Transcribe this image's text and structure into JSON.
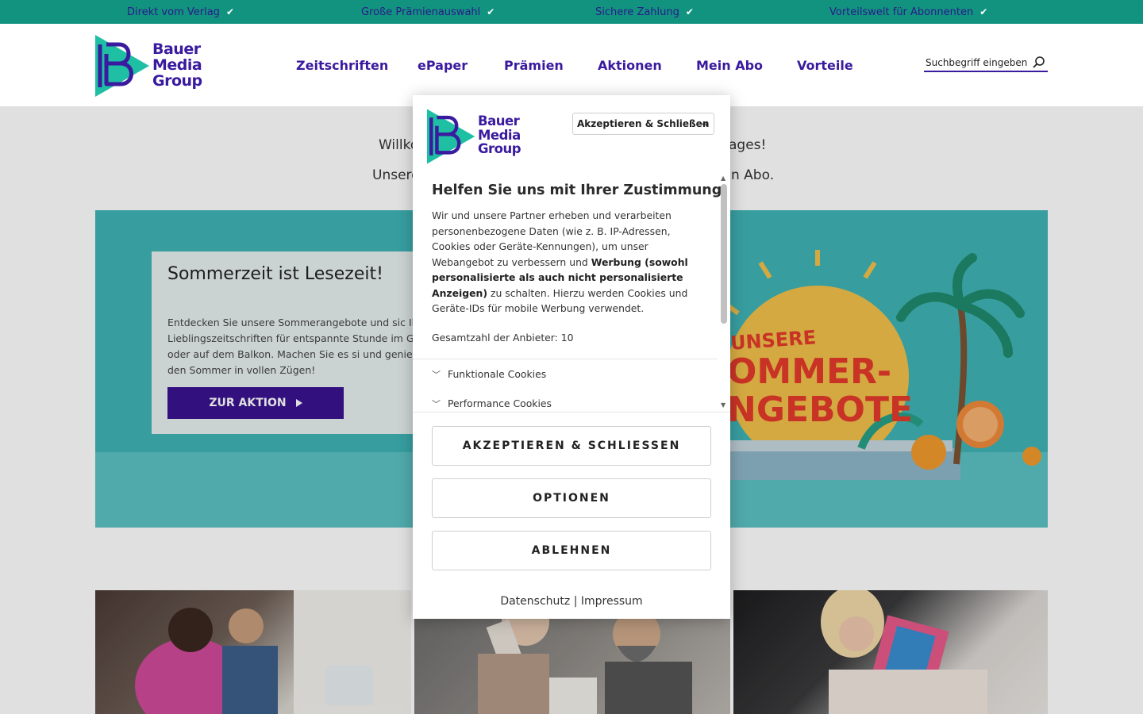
{
  "topbar": {
    "items": [
      {
        "label": "Direkt vom Verlag",
        "check": "✔"
      },
      {
        "label": "Große Prämienauswahl",
        "check": "✔"
      },
      {
        "label": "Sichere Zahlung",
        "check": "✔"
      },
      {
        "label": "Vorteilswelt für Abonnenten",
        "check": "✔"
      }
    ]
  },
  "brand": {
    "line1": "Bauer",
    "line2": "Media",
    "line3": "Group",
    "primary": "#3a1a9e",
    "accent": "#12937f"
  },
  "nav": [
    "Zeitschriften",
    "ePaper",
    "Prämien",
    "Aktionen",
    "Mein Abo",
    "Vorteile"
  ],
  "search": {
    "placeholder": "Suchbegriff eingeben",
    "icon": "search-icon"
  },
  "page": {
    "welcome_left": "Willko",
    "welcome_right": "ages!",
    "sub_left": "Unsere",
    "sub_right": "n Abo."
  },
  "hero": {
    "title": "Sommerzeit ist Lesezeit!",
    "desc": "Entdecken Sie unsere Sommerangebote und sic Ihre Lieblingszeitschriften für entspannte Stunde im Garten oder auf dem Balkon. Machen Sie es si und genießen Sie den Sommer in vollen Zügen!",
    "button": "ZUR AKTION",
    "promo_line1": "UNSERE",
    "promo_line2": "OMMER-",
    "promo_line3": "NGEBOTE"
  },
  "consent": {
    "accept_top": "Akzeptieren & Schließen",
    "title": "Helfen Sie uns mit Ihrer Zustimmung",
    "body_1": "Wir und unsere Partner erheben und verarbeiten personenbezogene Daten (wie z. B. IP-Adressen, Cookies oder Geräte-Kennungen), um unser Webangebot zu verbessern und ",
    "body_bold": "Werbung (sowohl personalisierte als auch nicht personalisierte Anzeigen)",
    "body_2": " zu schalten. Hierzu werden Cookies und Geräte-IDs für mobile Werbung verwendet.",
    "vendor_count": "Gesamtzahl der Anbieter: 10",
    "categories": [
      "Funktionale Cookies",
      "Performance Cookies"
    ],
    "btn_accept": "AKZEPTIEREN & SCHLIESSEN",
    "btn_options": "OPTIONEN",
    "btn_reject": "ABLEHNEN",
    "link_privacy": "Datenschutz",
    "link_sep": "|",
    "link_imprint": "Impressum"
  }
}
